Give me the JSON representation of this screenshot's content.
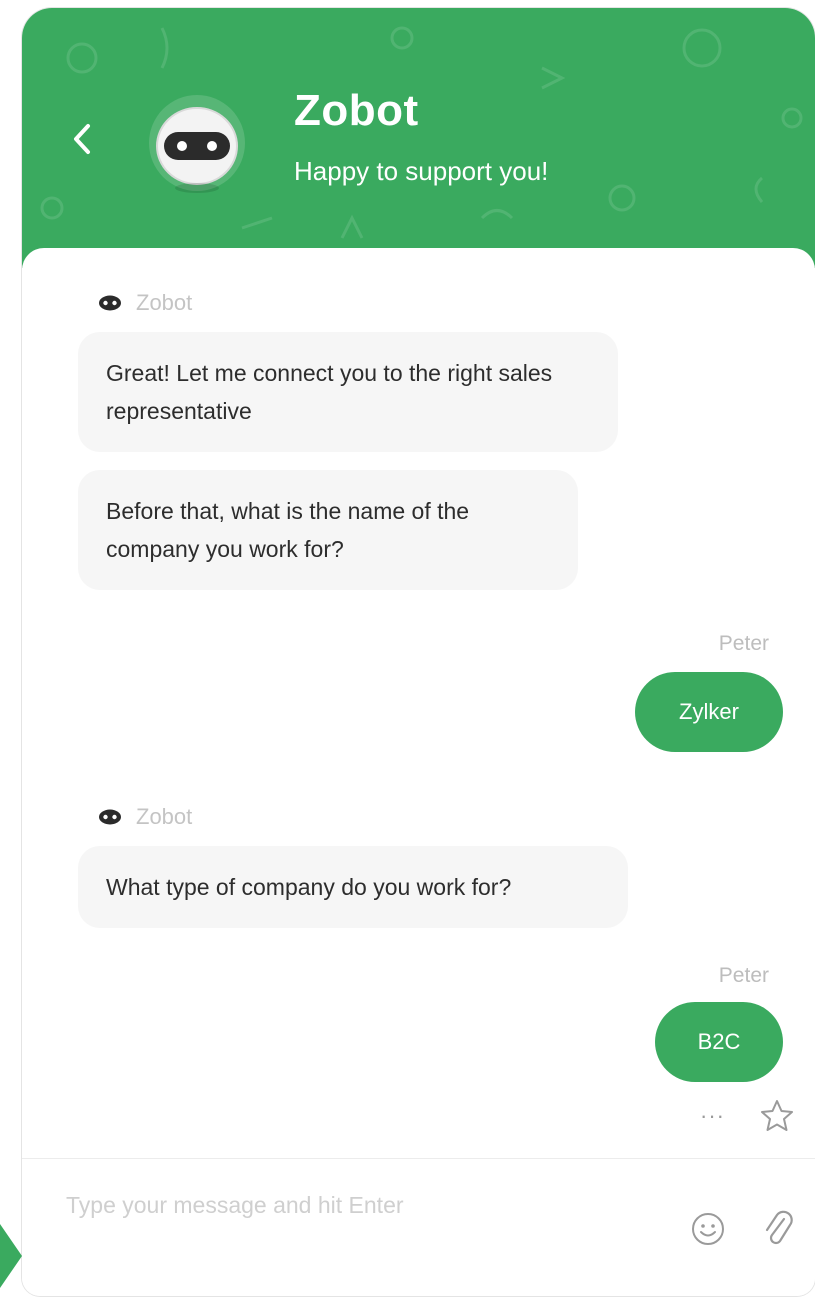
{
  "header": {
    "title": "Zobot",
    "tagline": "Happy to support you!",
    "back_icon": "chevron-left-icon",
    "background_color": "#3aaa5f"
  },
  "messages": [
    {
      "type": "sender",
      "name": "Zobot"
    },
    {
      "type": "bot",
      "text": "Great! Let me connect you to the right sales representative"
    },
    {
      "type": "bot",
      "text": "Before that, what is the name of the company you work for?"
    },
    {
      "type": "user_name",
      "name": "Peter"
    },
    {
      "type": "user",
      "text": "Zylker"
    },
    {
      "type": "sender",
      "name": "Zobot"
    },
    {
      "type": "bot",
      "text": "What type of company do you work for?"
    },
    {
      "type": "user_name",
      "name": "Peter"
    },
    {
      "type": "user",
      "text": "B2C"
    }
  ],
  "message_actions": {
    "more_label": "···",
    "more_icon": "more-horizontal-icon",
    "rate_icon": "star-outline-icon"
  },
  "composer": {
    "placeholder": "Type your message and hit Enter",
    "emoji_icon": "smiley-icon",
    "attach_icon": "paperclip-icon"
  },
  "colors": {
    "accent": "#3aaa5f",
    "bot_bubble": "#f6f6f6",
    "muted_text": "#c4c4c4"
  }
}
